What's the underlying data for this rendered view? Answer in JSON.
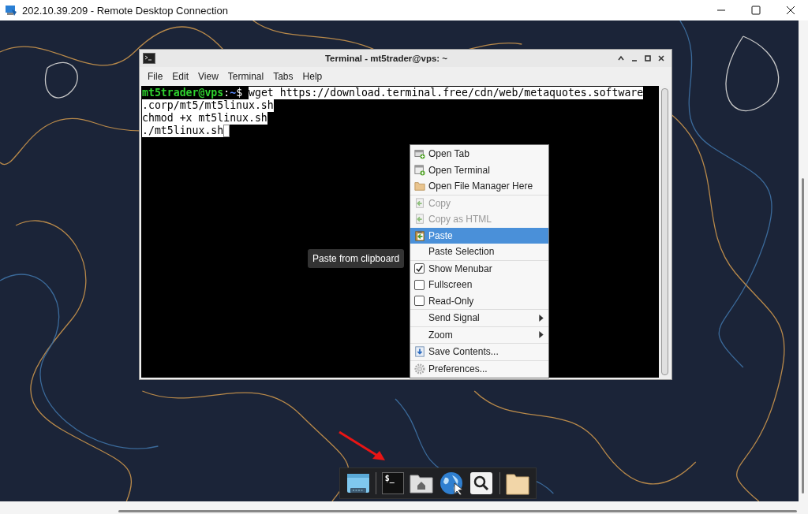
{
  "rdp_window": {
    "title": "202.10.39.209 - Remote Desktop Connection"
  },
  "terminal_window": {
    "title": "Terminal - mt5trader@vps: ~",
    "menubar": [
      {
        "label": "File"
      },
      {
        "label": "Edit"
      },
      {
        "label": "View"
      },
      {
        "label": "Terminal"
      },
      {
        "label": "Tabs"
      },
      {
        "label": "Help"
      }
    ],
    "prompt": {
      "user_host": "mt5trader@vps",
      "separator": ":",
      "path": "~",
      "symbol": "$"
    },
    "lines": [
      {
        "text": "wget https://download.terminal.free/cdn/web/metaquotes.software",
        "selected": true,
        "prompt": true
      },
      {
        "text": ".corp/mt5/mt5linux.sh",
        "selected": true,
        "prompt": false
      },
      {
        "text": "chmod +x mt5linux.sh",
        "selected": true,
        "prompt": false
      },
      {
        "text": "./mt5linux.sh",
        "selected": true,
        "prompt": false
      }
    ],
    "cursor": true
  },
  "context_menu": {
    "groups": [
      [
        {
          "label": "Open Tab",
          "kind": "action",
          "disabled": false,
          "selected": false
        },
        {
          "label": "Open Terminal",
          "kind": "action",
          "disabled": false,
          "selected": false
        },
        {
          "label": "Open File Manager Here",
          "kind": "action",
          "disabled": false,
          "selected": false
        }
      ],
      [
        {
          "label": "Copy",
          "kind": "action",
          "disabled": true,
          "selected": false
        },
        {
          "label": "Copy as HTML",
          "kind": "action",
          "disabled": true,
          "selected": false
        },
        {
          "label": "Paste",
          "kind": "action",
          "disabled": false,
          "selected": true
        },
        {
          "label": "Paste Selection",
          "kind": "action",
          "selected": false
        }
      ],
      [
        {
          "label": "Show Menubar",
          "kind": "check",
          "checked": true,
          "selected": false
        },
        {
          "label": "Fullscreen",
          "kind": "check",
          "checked": false,
          "selected": false
        },
        {
          "label": "Read-Only",
          "kind": "check",
          "checked": false,
          "selected": false
        }
      ],
      [
        {
          "label": "Send Signal",
          "kind": "submenu",
          "selected": false
        }
      ],
      [
        {
          "label": "Zoom",
          "kind": "submenu",
          "selected": false
        }
      ],
      [
        {
          "label": "Save Contents...",
          "kind": "action",
          "disabled": false,
          "selected": false
        }
      ],
      [
        {
          "label": "Preferences...",
          "kind": "action",
          "disabled": false,
          "selected": false
        }
      ]
    ]
  },
  "tooltip": {
    "text": "Paste from clipboard"
  },
  "dock": {
    "items": [
      {
        "kind": "desktop"
      },
      {
        "kind": "separator"
      },
      {
        "kind": "terminal",
        "glyph": "$_"
      },
      {
        "kind": "home"
      },
      {
        "kind": "globe"
      },
      {
        "kind": "search"
      },
      {
        "kind": "separator"
      },
      {
        "kind": "folder"
      }
    ]
  }
}
